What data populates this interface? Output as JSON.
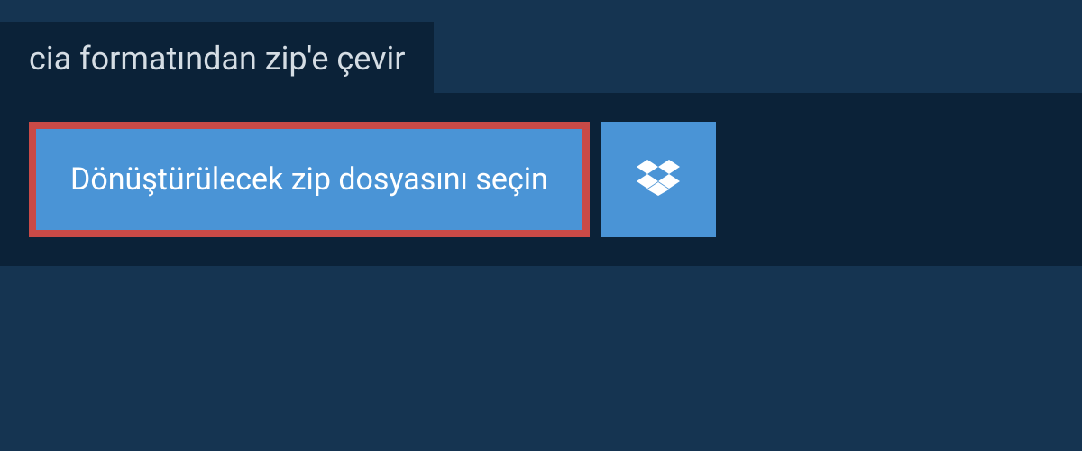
{
  "tab": {
    "label": "cia formatından zip'e çevir"
  },
  "panel": {
    "select_button_label": "Dönüştürülecek zip dosyasını seçin",
    "dropbox_icon": "dropbox"
  },
  "colors": {
    "background": "#153451",
    "panel": "#0b2238",
    "button": "#4a94d6",
    "highlight_border": "#c94a47"
  }
}
